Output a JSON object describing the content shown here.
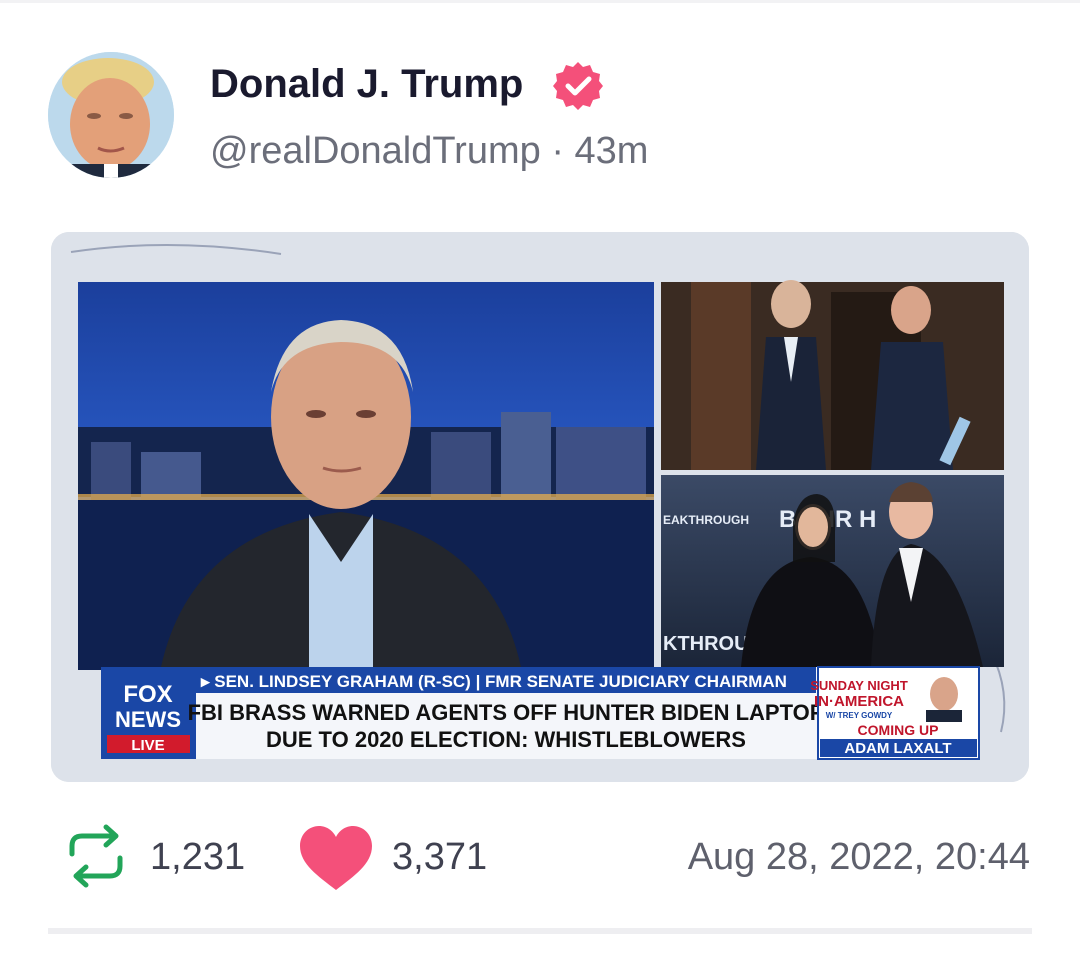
{
  "post": {
    "display_name": "Donald J. Trump",
    "handle": "@realDonaldTrump",
    "separator": "·",
    "age": "43m",
    "verified_icon": "verified-badge-icon",
    "avatar_icon": "profile-avatar"
  },
  "media": {
    "chyron": {
      "name_line": "▸ SEN. LINDSEY GRAHAM (R-SC) | FMR SENATE JUDICIARY CHAIRMAN",
      "headline_1": "FBI BRASS WARNED AGENTS OFF HUNTER BIDEN LAPTOP",
      "headline_2": "DUE TO 2020 ELECTION: WHISTLEBLOWERS",
      "logo_1": "FOX",
      "logo_2": "NEWS",
      "live": "LIVE",
      "promo_1": "SUNDAY NIGHT",
      "promo_2": "IN·AMERICA",
      "promo_3": "W/ TREY GOWDY",
      "promo_4": "COMING UP",
      "promo_5": "ADAM LAXALT"
    },
    "backdrop_text_1": "EAKTHROUGH",
    "backdrop_text_2": "B    THR    H",
    "backdrop_text_3": "KTHROUG"
  },
  "stats": {
    "retweets": "1,231",
    "likes": "3,371",
    "timestamp": "Aug 28, 2022, 20:44"
  },
  "colors": {
    "accent_pink": "#f4507a",
    "retweet_green": "#22a559",
    "name_text": "#1a1a2e",
    "muted_text": "#6b6e7a"
  }
}
